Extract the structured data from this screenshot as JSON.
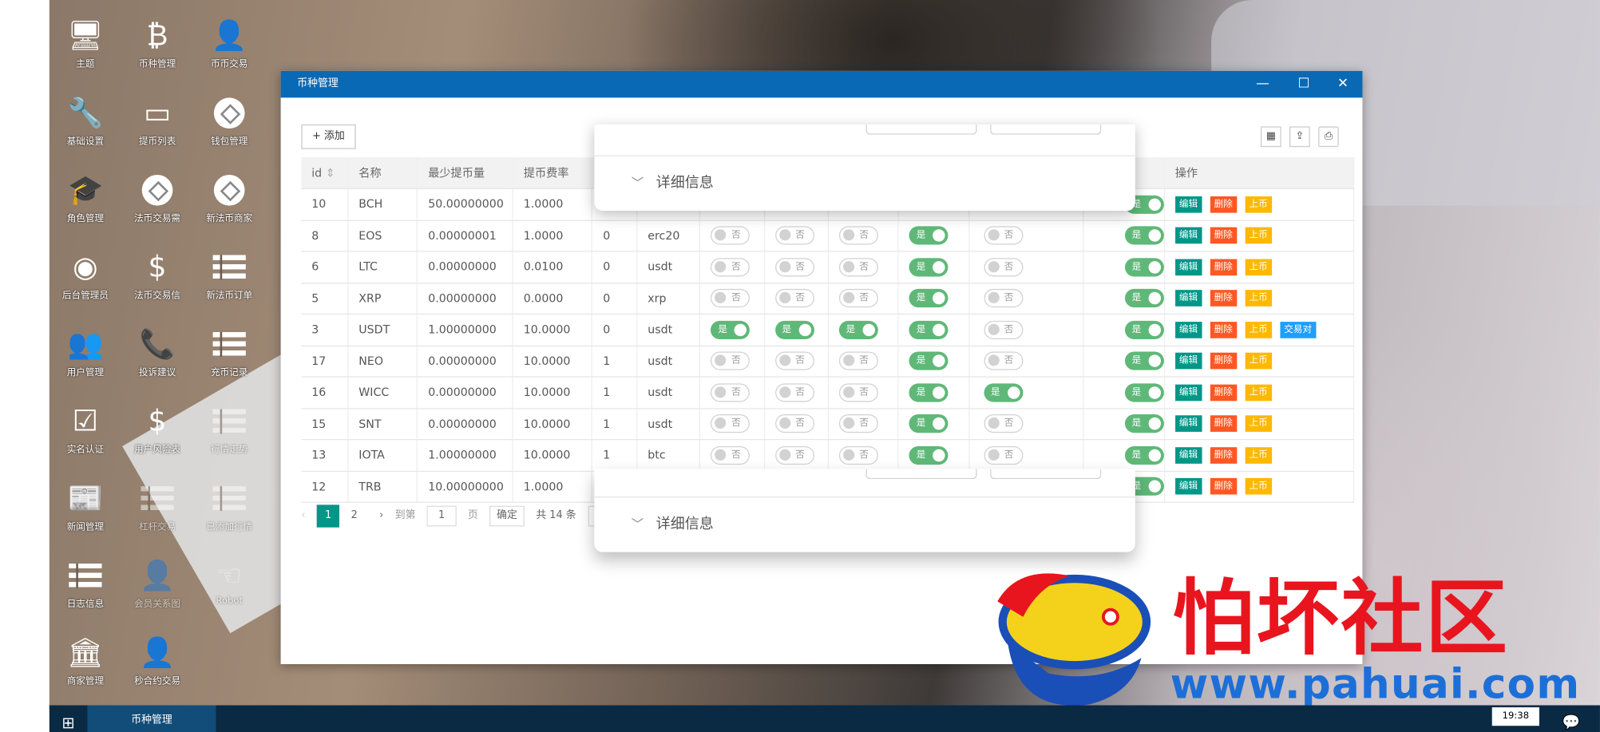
{
  "desktop_icons": [
    {
      "label": "主题",
      "icon": "monitor-icon",
      "glyph": "🖥"
    },
    {
      "label": "币种管理",
      "icon": "bitcoin-icon",
      "glyph": "₿"
    },
    {
      "label": "币币交易",
      "icon": "user-plus-icon",
      "glyph": "👤"
    },
    {
      "label": "基础设置",
      "icon": "wrench-icon",
      "glyph": "🔧"
    },
    {
      "label": "提币列表",
      "icon": "credit-card-icon",
      "glyph": "▭"
    },
    {
      "label": "钱包管理",
      "icon": "circle-arrows-icon",
      "glyph": ""
    },
    {
      "label": "角色管理",
      "icon": "graduation-cap-icon",
      "glyph": "🎓"
    },
    {
      "label": "法币交易需",
      "icon": "circle-arrows-icon",
      "glyph": ""
    },
    {
      "label": "新法币商家",
      "icon": "circle-arrows-icon",
      "glyph": ""
    },
    {
      "label": "后台管理员",
      "icon": "user-circle-icon",
      "glyph": "◉"
    },
    {
      "label": "法币交易信",
      "icon": "dollar-icon",
      "glyph": "$"
    },
    {
      "label": "新法币订单",
      "icon": "list-icon",
      "glyph": ""
    },
    {
      "label": "用户管理",
      "icon": "users-icon",
      "glyph": "👥"
    },
    {
      "label": "投诉建议",
      "icon": "phone-icon",
      "glyph": "📞"
    },
    {
      "label": "充币记录",
      "icon": "list-icon",
      "glyph": ""
    },
    {
      "label": "实名认证",
      "icon": "checkbox-icon",
      "glyph": "☑"
    },
    {
      "label": "用户风险表",
      "icon": "dollar-icon",
      "glyph": "$"
    },
    {
      "label": "行情走势",
      "icon": "list-icon",
      "glyph": ""
    },
    {
      "label": "新闻管理",
      "icon": "newspaper-icon",
      "glyph": "📰"
    },
    {
      "label": "杠杆交易",
      "icon": "list-icon",
      "glyph": ""
    },
    {
      "label": "已添加行情",
      "icon": "list-icon",
      "glyph": ""
    },
    {
      "label": "日志信息",
      "icon": "list-icon",
      "glyph": ""
    },
    {
      "label": "会员关系图",
      "icon": "user-plus-icon",
      "glyph": "👤"
    },
    {
      "label": "Robot",
      "icon": "hand-icon",
      "glyph": "☜"
    },
    {
      "label": "商家管理",
      "icon": "bank-icon",
      "glyph": "🏛"
    },
    {
      "label": "秒合约交易",
      "icon": "user-plus-icon",
      "glyph": "👤"
    }
  ],
  "window": {
    "title": "币种管理",
    "minimize": "—",
    "maximize": "☐",
    "close": "✕"
  },
  "toolbar": {
    "add_label": "添加",
    "add_icon": "+",
    "cols_icon": "▦",
    "export_icon": "⇪",
    "print_icon": "⎙"
  },
  "table": {
    "headers": {
      "id": "id",
      "sort": "⇕",
      "name": "名称",
      "min": "最少提币量",
      "fee": "提币费率",
      "ops": "操作"
    },
    "rows": [
      {
        "id": "10",
        "name": "BCH",
        "min": "50.00000000",
        "fee": "1.0000",
        "c4": "",
        "c5": "",
        "s": [
          null,
          null,
          null,
          null,
          null,
          true
        ],
        "trade": false
      },
      {
        "id": "8",
        "name": "EOS",
        "min": "0.00000001",
        "fee": "1.0000",
        "c4": "0",
        "c5": "erc20",
        "s": [
          false,
          false,
          false,
          true,
          false,
          true
        ],
        "trade": false
      },
      {
        "id": "6",
        "name": "LTC",
        "min": "0.00000000",
        "fee": "0.0100",
        "c4": "0",
        "c5": "usdt",
        "s": [
          false,
          false,
          false,
          true,
          false,
          true
        ],
        "trade": false
      },
      {
        "id": "5",
        "name": "XRP",
        "min": "0.00000000",
        "fee": "0.0000",
        "c4": "0",
        "c5": "xrp",
        "s": [
          false,
          false,
          false,
          true,
          false,
          true
        ],
        "trade": false
      },
      {
        "id": "3",
        "name": "USDT",
        "min": "1.00000000",
        "fee": "10.0000",
        "c4": "0",
        "c5": "usdt",
        "s": [
          true,
          true,
          true,
          true,
          false,
          true
        ],
        "trade": true
      },
      {
        "id": "17",
        "name": "NEO",
        "min": "0.00000000",
        "fee": "10.0000",
        "c4": "1",
        "c5": "usdt",
        "s": [
          false,
          false,
          false,
          true,
          false,
          true
        ],
        "trade": false
      },
      {
        "id": "16",
        "name": "WICC",
        "min": "0.00000000",
        "fee": "10.0000",
        "c4": "1",
        "c5": "usdt",
        "s": [
          false,
          false,
          false,
          true,
          true,
          true
        ],
        "trade": false
      },
      {
        "id": "15",
        "name": "SNT",
        "min": "0.00000000",
        "fee": "10.0000",
        "c4": "1",
        "c5": "usdt",
        "s": [
          false,
          false,
          false,
          true,
          false,
          true
        ],
        "trade": false
      },
      {
        "id": "13",
        "name": "IOTA",
        "min": "1.00000000",
        "fee": "10.0000",
        "c4": "1",
        "c5": "btc",
        "s": [
          false,
          false,
          false,
          true,
          false,
          true
        ],
        "trade": false
      },
      {
        "id": "12",
        "name": "TRB",
        "min": "10.00000000",
        "fee": "1.0000",
        "c4": "",
        "c5": "",
        "s": [
          null,
          null,
          null,
          null,
          null,
          true
        ],
        "trade": false
      }
    ],
    "switch_on": "是",
    "switch_off": "否",
    "btn_edit": "编辑",
    "btn_delete": "删除",
    "btn_up": "上币",
    "btn_trade": "交易对"
  },
  "pager": {
    "prev": "‹",
    "p1": "1",
    "p2": "2",
    "next": "›",
    "goto": "到第",
    "page_input": "1",
    "page_unit": "页",
    "confirm": "确定",
    "total": "共 14 条",
    "size": "10"
  },
  "overlay": {
    "details": "详细信息",
    "chevron": "﹀"
  },
  "taskbar": {
    "start_icon": "⊞",
    "task_label": "币种管理",
    "clock": "19:38",
    "msg_icon": "💬"
  },
  "watermark": {
    "text": "怕坏社区",
    "url": "www.pahuai.com"
  }
}
